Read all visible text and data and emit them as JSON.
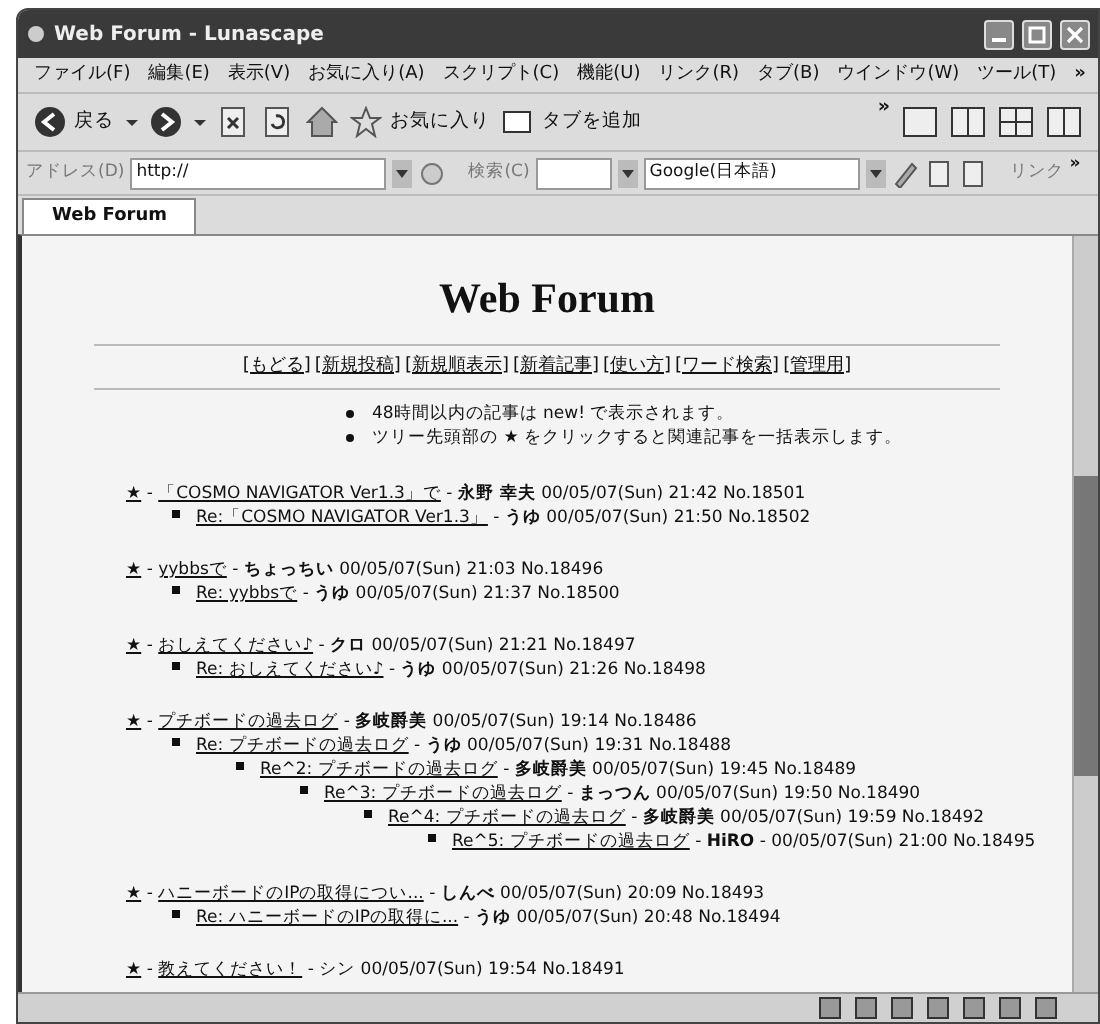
{
  "window": {
    "title": "Web Forum - Lunascape"
  },
  "menu": {
    "items": [
      "ファイル(F)",
      "編集(E)",
      "表示(V)",
      "お気に入り(A)",
      "スクリプト(C)",
      "機能(U)",
      "リンク(R)",
      "タブ(B)",
      "ウインドウ(W)",
      "ツール(T)"
    ],
    "overflow": "»"
  },
  "toolbar": {
    "back": "戻る",
    "favorites": "お気に入り",
    "add_tab": "タブを追加",
    "overflow": "»"
  },
  "address_bar": {
    "label": "アドレス(D)",
    "value": "http://",
    "search_label": "検索(C)",
    "engine": "Google(日本語)",
    "links_label": "リンク",
    "overflow": "»"
  },
  "tabs": [
    {
      "label": "Web Forum",
      "selected": true
    }
  ],
  "page": {
    "heading": "Web Forum",
    "nav_links": [
      "[もどる]",
      "[新規投稿]",
      "[新規順表示]",
      "[新着記事]",
      "[使い方]",
      "[ワード検索]",
      "[管理用]"
    ],
    "notes": [
      "48時間以内の記事は new! で表示されます。",
      "ツリー先頭部の ★ をクリックすると関連記事を一括表示します。"
    ],
    "threads": [
      {
        "marker": "★",
        "lead": "-",
        "title": "「COSMO NAVIGATOR Ver1.3」で",
        "byline": "- **永野 幸夫** 00/05/07(Sun) 21:42 No.18501",
        "children": [
          {
            "title": "Re:「COSMO NAVIGATOR Ver1.3」",
            "byline": "- **うゆ** 00/05/07(Sun) 21:50 No.18502"
          }
        ]
      },
      {
        "marker": "★",
        "lead": "-",
        "title": "yybbsで",
        "byline": "- **ちょっちい** 00/05/07(Sun) 21:03 No.18496",
        "children": [
          {
            "title": "Re: yybbsで",
            "byline": "- **うゆ** 00/05/07(Sun) 21:37 No.18500"
          }
        ]
      },
      {
        "marker": "★",
        "lead": "-",
        "title": "おしえてください♪",
        "byline": "- **クロ** 00/05/07(Sun) 21:21 No.18497",
        "children": [
          {
            "title": "Re: おしえてください♪",
            "byline": "- **うゆ** 00/05/07(Sun) 21:26 No.18498"
          }
        ]
      },
      {
        "marker": "★",
        "lead": "-",
        "title": "プチボードの過去ログ",
        "byline": "- **多岐爵美** 00/05/07(Sun) 19:14 No.18486",
        "children": [
          {
            "title": "Re: プチボードの過去ログ",
            "byline": "- **うゆ** 00/05/07(Sun) 19:31 No.18488",
            "children": [
              {
                "title": "Re^2: プチボードの過去ログ",
                "byline": "- **多岐爵美** 00/05/07(Sun) 19:45 No.18489",
                "children": [
                  {
                    "title": "Re^3: プチボードの過去ログ",
                    "byline": "- **まっつん** 00/05/07(Sun) 19:50 No.18490",
                    "children": [
                      {
                        "title": "Re^4: プチボードの過去ログ",
                        "byline": "- **多岐爵美** 00/05/07(Sun) 19:59 No.18492",
                        "children": [
                          {
                            "title": "Re^5: プチボードの過去ログ",
                            "byline": "- **HiRO** - 00/05/07(Sun) 21:00 No.18495"
                          }
                        ]
                      }
                    ]
                  }
                ]
              }
            ]
          }
        ]
      },
      {
        "marker": "★",
        "lead": "-",
        "title": "ハニーボードのIPの取得につい...",
        "byline": "- **しんべ** 00/05/07(Sun) 20:09 No.18493",
        "children": [
          {
            "title": "Re: ハニーボードのIPの取得に...",
            "byline": "- **うゆ** 00/05/07(Sun) 20:48 No.18494"
          }
        ]
      },
      {
        "marker": "★",
        "lead": "-",
        "title": "教えてください！",
        "byline": "- シン 00/05/07(Sun) 19:54 No.18491"
      }
    ]
  }
}
